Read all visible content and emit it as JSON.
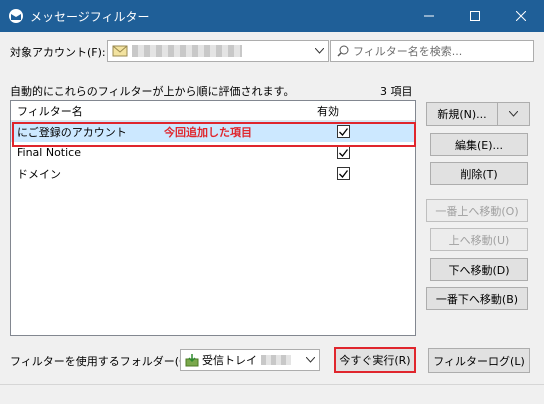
{
  "window": {
    "title": "メッセージフィルター",
    "minimize": "—",
    "maximize": "☐",
    "close": "✕"
  },
  "account": {
    "label": "対象アカウント(F):"
  },
  "search": {
    "placeholder": "フィルター名を検索..."
  },
  "info": {
    "text": "自動的にこれらのフィルターが上から順に評価されます。",
    "count": "3 項目"
  },
  "list": {
    "headers": {
      "name": "フィルター名",
      "enabled": "有効"
    },
    "rows": [
      {
        "name": "にご登録のアカウント",
        "enabled": true
      },
      {
        "name": "Final Notice",
        "enabled": true
      },
      {
        "name": "ドメイン",
        "enabled": true
      }
    ],
    "annotation": "今回追加した項目"
  },
  "buttons": {
    "new": "新規(N)...",
    "edit": "編集(E)...",
    "delete": "削除(T)",
    "move_top": "一番上へ移動(O)",
    "move_up": "上へ移動(U)",
    "move_down": "下へ移動(D)",
    "move_bottom": "一番下へ移動(B)",
    "run_now": "今すぐ実行(R)",
    "filter_log": "フィルターログ(L)"
  },
  "folder": {
    "label": "フィルターを使用するフォルダー(C):",
    "value": "受信トレイ"
  },
  "colors": {
    "titlebar": "#1f5f98",
    "highlight": "#e0262d",
    "selection": "#cce8ff"
  }
}
